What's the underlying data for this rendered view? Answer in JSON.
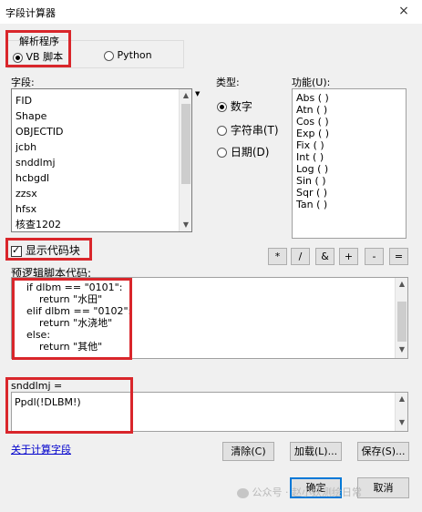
{
  "window": {
    "title": "字段计算器",
    "close_glyph": "×"
  },
  "parser": {
    "label": "解析程序",
    "options": [
      "VB 脚本",
      "Python"
    ],
    "selected": "VB 脚本"
  },
  "fields": {
    "label": "字段:",
    "items": [
      "FID",
      "Shape",
      "OBJECTID",
      "jcbh",
      "snddlmj",
      "hcbgdl",
      "zzsx",
      "hfsx",
      "核查1202"
    ]
  },
  "type": {
    "label": "类型:",
    "options": [
      "数字",
      "字符串(T)",
      "日期(D)"
    ],
    "selected": "数字"
  },
  "functions": {
    "label": "功能(U):",
    "items": [
      "Abs ( )",
      "Atn ( )",
      "Cos ( )",
      "Exp ( )",
      "Fix ( )",
      "Int ( )",
      "Log ( )",
      "Sin ( )",
      "Sqr ( )",
      "Tan ( )"
    ]
  },
  "show_codeblock": {
    "label": "显示代码块",
    "checked": true
  },
  "operators": [
    "*",
    "/",
    "&",
    "+",
    "-",
    "="
  ],
  "prelogic": {
    "label": "预逻辑脚本代码:",
    "code": "if dlbm == \"0101\":\n    return \"水田\"\nelif dlbm == \"0102\":\n    return \"水浇地\"\nelse:\n    return \"其他\""
  },
  "expression": {
    "label": "snddlmj =",
    "value": "Ppdl(!DLBM!)"
  },
  "footer": {
    "help_link": "关于计算字段",
    "clear": "清除(C)",
    "load": "加载(L)...",
    "save": "保存(S)...",
    "ok": "确定",
    "cancel": "取消"
  },
  "watermark": "公众号 · 赵小妖测绘日常"
}
